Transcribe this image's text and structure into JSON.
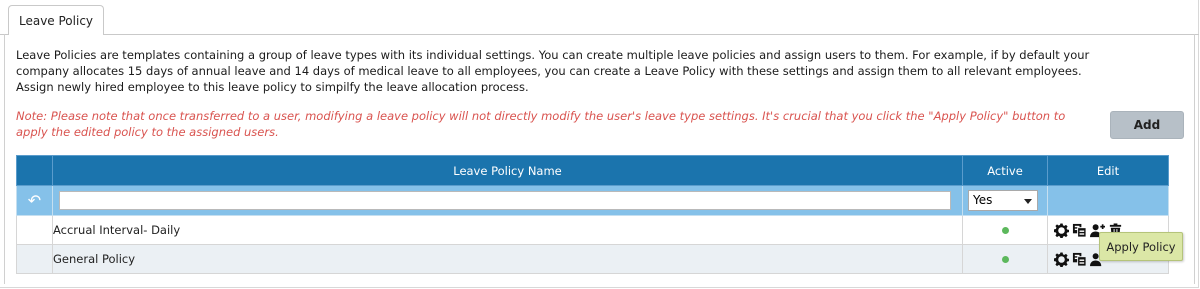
{
  "tab": {
    "label": "Leave Policy"
  },
  "description": "Leave Policies are templates containing a group of leave types with its individual settings. You can create multiple leave policies and assign users to them. For example, if by default your company allocates 15 days of annual leave and 14 days of medical leave to all employees, you can create a Leave Policy with these settings and assign them to all relevant employees. Assign newly hired employee to this leave policy to simpilfy the leave allocation process.",
  "note": "Note: Please note that once transferred to a user, modifying a leave policy will not directly modify the user's leave type settings. It's crucial that you click the \"Apply Policy\" button to apply the edited policy to the assigned users.",
  "add_button": "Add",
  "table": {
    "headers": {
      "name": "Leave Policy Name",
      "active": "Active",
      "edit": "Edit"
    },
    "filter": {
      "name_value": "",
      "active_value": "Yes"
    },
    "rows": [
      {
        "name": "Accrual Interval- Daily",
        "active": true
      },
      {
        "name": "General Policy",
        "active": true
      }
    ]
  },
  "tooltip": "Apply Policy",
  "colors": {
    "header": "#1b74ad",
    "filter_row": "#85c1e9",
    "note": "#d9534f",
    "active_dot": "#5cb85c",
    "tooltip": "#dbe7a6"
  }
}
